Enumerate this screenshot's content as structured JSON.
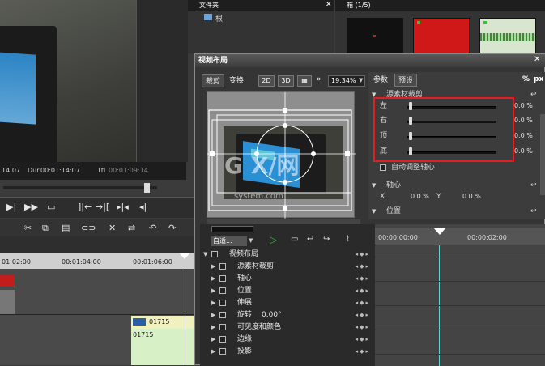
{
  "preview": {
    "timecode_in": "14:07",
    "dur_label": "Dur",
    "dur_value": "00:01:14:07",
    "ttl_label": "Ttl",
    "ttl_value": "00:01:09:14"
  },
  "timeline": {
    "ruler": [
      "01:02:00",
      "00:01:04:00",
      "00:01:06:00"
    ],
    "clip_label_1": "01715",
    "clip_label_2": "01715"
  },
  "folder_panel": {
    "title": "文件夹",
    "root": "根"
  },
  "bin_panel": {
    "title": "箱 (1/5)"
  },
  "dialog": {
    "title": "视频布局",
    "tab_crop": "裁剪",
    "tab_transform": "变换",
    "btn_2d": "2D",
    "btn_3d": "3D",
    "zoom": "19.34%",
    "params_tab": "参数",
    "preset_tab": "预设",
    "percent_btn": "%",
    "px_btn": "px",
    "section_source_crop": "源素材裁剪",
    "crop_left": "左",
    "crop_right": "右",
    "crop_top": "顶",
    "crop_bottom": "底",
    "crop_left_val": "0.0 %",
    "crop_right_val": "0.0 %",
    "crop_top_val": "0.0 %",
    "crop_bottom_val": "0.0 %",
    "auto_adjust_axis": "自动调整轴心",
    "section_axis": "轴心",
    "axis_x_label": "X",
    "axis_x_val": "0.0 %",
    "axis_y_label": "Y",
    "axis_y_val": "0.0 %",
    "section_position": "位置",
    "kf_mode": "自适...",
    "kf_time_1": "00:00:00:00",
    "kf_time_2": "00:00:02:00",
    "kf_items": [
      "视频布局",
      "源素材裁剪",
      "轴心",
      "位置",
      "伸展",
      "旋转",
      "可见度和颜色",
      "边缘",
      "投影"
    ],
    "rotation_val": "0.00°"
  },
  "colors": {
    "highlight": "#e02020",
    "accent_green": "#36c33a",
    "dark": "#2a2a2a"
  }
}
